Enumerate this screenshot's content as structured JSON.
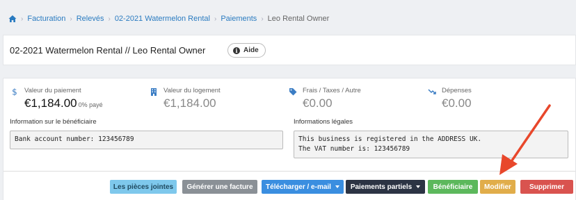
{
  "breadcrumb": {
    "items": [
      "Facturation",
      "Relevés",
      "02-2021 Watermelon Rental",
      "Paiements"
    ],
    "current": "Leo Rental Owner"
  },
  "header": {
    "title": "02-2021 Watermelon Rental // Leo Rental Owner",
    "help_label": "Aide"
  },
  "stats": [
    {
      "label": "Valeur du paiement",
      "value": "€1,184.00",
      "suffix": "0% payé",
      "icon": "dollar-icon"
    },
    {
      "label": "Valeur du logement",
      "value": "€1,184.00",
      "icon": "building-icon"
    },
    {
      "label": "Frais / Taxes / Autre",
      "value": "€0.00",
      "icon": "tag-icon"
    },
    {
      "label": "Dépenses",
      "value": "€0.00",
      "icon": "trending-down-icon"
    }
  ],
  "beneficiary": {
    "label": "Information sur le bénéficiaire",
    "line1": "Bank account number: 123456789"
  },
  "legal": {
    "label": "Informations légales",
    "line1": "This business is registered in the ADDRESS UK.",
    "line2": "The VAT number is: 123456789"
  },
  "actions": {
    "attachments": "Les pièces jointes",
    "invoice": "Générer une facture",
    "download": "Télécharger / e-mail",
    "partial": "Paiements partiels",
    "beneficiary": "Bénéficiaire",
    "edit": "Modifier",
    "delete": "Supprimer"
  },
  "colors": {
    "link": "#2a7bc0",
    "attachments": "#7ec8ec",
    "invoice": "#8a9096",
    "download": "#3a8ee0",
    "partial": "#2c3444",
    "beneficiary": "#5cb85c",
    "edit": "#e1ad4a",
    "delete": "#d9534f",
    "annotation_arrow": "#e8472b"
  }
}
